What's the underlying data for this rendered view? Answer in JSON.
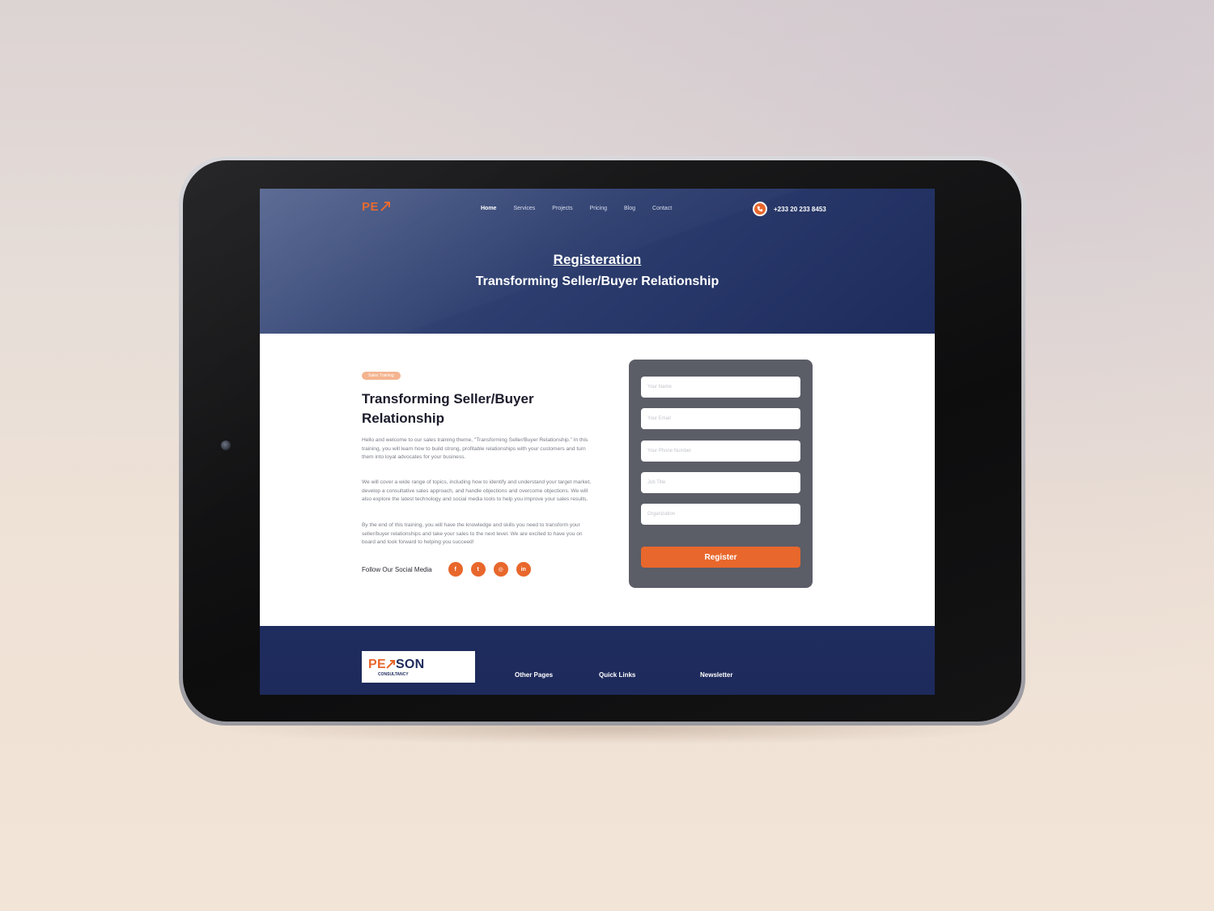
{
  "header": {
    "logo_text": "PE",
    "nav": [
      {
        "label": "Home",
        "active": true
      },
      {
        "label": "Services",
        "active": false
      },
      {
        "label": "Projects",
        "active": false
      },
      {
        "label": "Pricing",
        "active": false
      },
      {
        "label": "Blog",
        "active": false
      },
      {
        "label": "Contact",
        "active": false
      }
    ],
    "phone": "+233 20 233 8453"
  },
  "hero": {
    "title": "Registeration",
    "subtitle": "Transforming Seller/Buyer Relationship"
  },
  "main": {
    "tag": "Sales Training",
    "title": "Transforming Seller/Buyer Relationship",
    "paragraphs": [
      "Hello and welcome to our sales training theme, \"Transforming Seller/Buyer Relationship.\" In this training, you will learn how to build strong, profitable relationships with your customers and turn them into loyal advocates for your business.",
      "We will cover a wide range of topics, including how to identify and understand your target market, develop a consultative sales approach, and handle objections and overcome objections. We will also explore the latest technology and social media tools to help you improve your sales results.",
      "By the end of this training, you will have the knowledge and skills you need to transform your seller/buyer relationships and take your sales to the next level. We are excited to have you on board and look forward to helping you succeed!"
    ],
    "follow_label": "Follow Our Social Media",
    "social": [
      {
        "icon": "facebook-icon",
        "glyph": "f"
      },
      {
        "icon": "twitter-icon",
        "glyph": "t"
      },
      {
        "icon": "instagram-icon",
        "glyph": "◎"
      },
      {
        "icon": "linkedin-icon",
        "glyph": "in"
      }
    ]
  },
  "form": {
    "fields": [
      {
        "placeholder": "Your Name",
        "value": ""
      },
      {
        "placeholder": "Your Email",
        "value": ""
      },
      {
        "placeholder": "Your Phone Number",
        "value": ""
      },
      {
        "placeholder": "Job Title",
        "value": ""
      },
      {
        "placeholder": "Organization",
        "value": ""
      }
    ],
    "submit_label": "Register"
  },
  "footer": {
    "logo_pe": "PE",
    "logo_rest": "SON",
    "logo_sub": "CONSULTANCY",
    "headings": [
      "Other Pages",
      "Quick Links",
      "Newsletter"
    ]
  },
  "colors": {
    "accent": "#e8672c",
    "navy": "#1d2a5b",
    "form_bg": "#5b5d67"
  }
}
